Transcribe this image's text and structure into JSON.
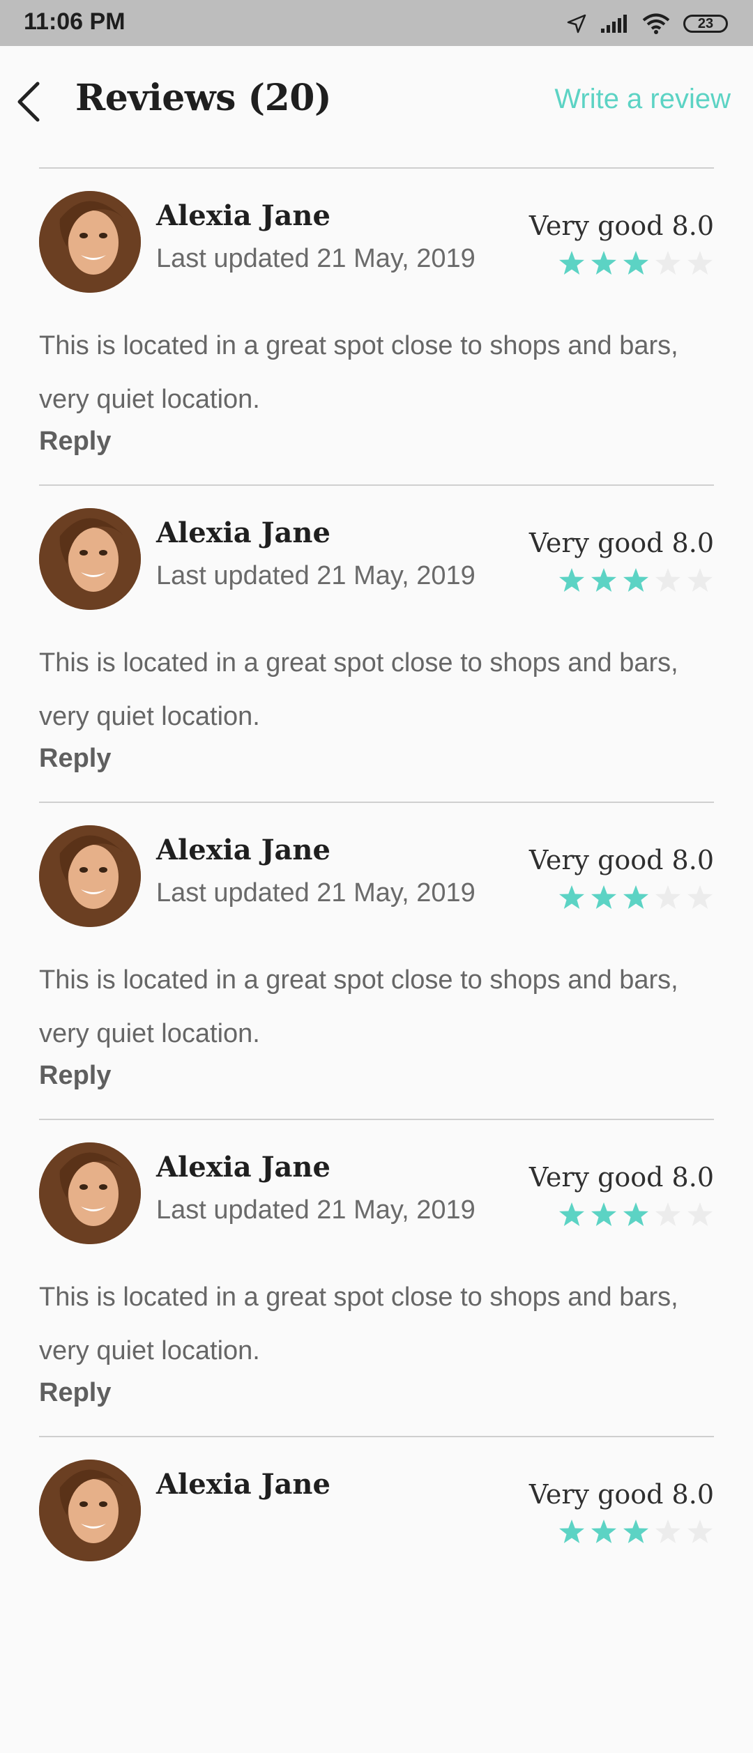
{
  "status_bar": {
    "time": "11:06 PM",
    "battery": "23",
    "icons": [
      "location-arrow-icon",
      "signal-icon",
      "wifi-icon",
      "battery-icon"
    ]
  },
  "header": {
    "title": "Reviews (20)",
    "write_review": "Write a review",
    "back_icon": "chevron-left-icon"
  },
  "colors": {
    "accent": "#5cd3c4",
    "star_empty": "#ececec",
    "divider": "#cfcfcf"
  },
  "reviews": [
    {
      "name": "Alexia Jane",
      "date": "Last updated 21 May, 2019",
      "rating_label": "Very good 8.0",
      "stars": 3,
      "max_stars": 5,
      "text": "This is located in a great spot close to shops and bars, very quiet location.",
      "reply": "Reply"
    },
    {
      "name": "Alexia Jane",
      "date": "Last updated 21 May, 2019",
      "rating_label": "Very good 8.0",
      "stars": 3,
      "max_stars": 5,
      "text": "This is located in a great spot close to shops and bars, very quiet location.",
      "reply": "Reply"
    },
    {
      "name": "Alexia Jane",
      "date": "Last updated 21 May, 2019",
      "rating_label": "Very good 8.0",
      "stars": 3,
      "max_stars": 5,
      "text": "This is located in a great spot close to shops and bars, very quiet location.",
      "reply": "Reply"
    },
    {
      "name": "Alexia Jane",
      "date": "Last updated 21 May, 2019",
      "rating_label": "Very good 8.0",
      "stars": 3,
      "max_stars": 5,
      "text": "This is located in a great spot close to shops and bars, very quiet location.",
      "reply": "Reply"
    },
    {
      "name": "Alexia Jane",
      "date": "",
      "rating_label": "Very good 8.0",
      "stars": 3,
      "max_stars": 5,
      "text": "",
      "reply": ""
    }
  ]
}
